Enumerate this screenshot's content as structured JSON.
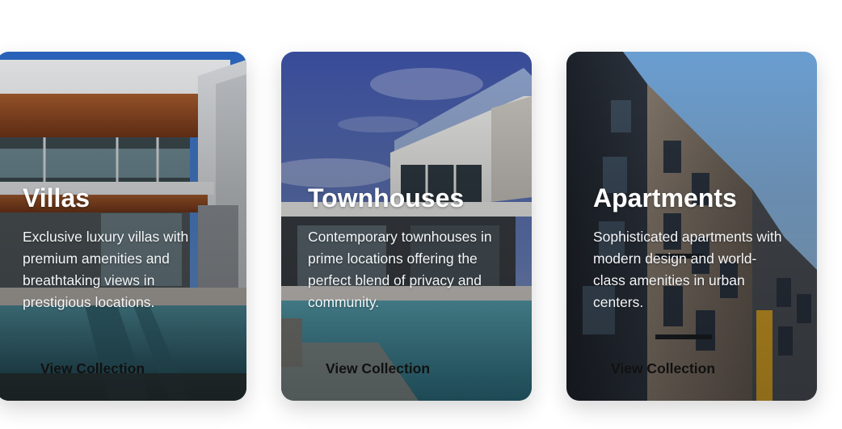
{
  "cards": [
    {
      "title": "Villas",
      "description": "Exclusive luxury villas with premium amenities and breathtaking views in prestigious locations.",
      "button_label": "View Collection",
      "image": "luxury-villa-with-pool"
    },
    {
      "title": "Townhouses",
      "description": "Contemporary townhouses in prime locations offering the perfect blend of privacy and community.",
      "button_label": "View Collection",
      "image": "modern-townhouse-with-pool"
    },
    {
      "title": "Apartments",
      "description": "Sophisticated apartments with modern design and world-class amenities in urban centers.",
      "button_label": "View Collection",
      "image": "apartment-building-exterior"
    }
  ]
}
